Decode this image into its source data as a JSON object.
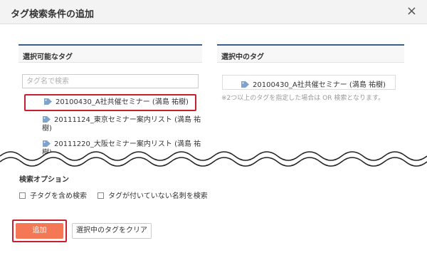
{
  "dialog": {
    "title": "タグ検索条件の追加",
    "close_icon": "×"
  },
  "available": {
    "heading": "選択可能なタグ",
    "search_placeholder": "タグ名で検索",
    "items": [
      {
        "label": "20100430_A社共催セミナー (満島 祐樹)"
      },
      {
        "label": "20111124_東京セミナー案内リスト (満島 祐",
        "wrap": "樹)"
      },
      {
        "label": "20111220_大阪セミナー案内リスト (満島 祐",
        "wrap": "樹)"
      }
    ]
  },
  "selected": {
    "heading": "選択中のタグ",
    "items": [
      {
        "label": "20100430_A社共催セミナー (満島 祐樹)"
      }
    ],
    "note": "※2つ以上のタグを指定した場合は OR 検索となります。"
  },
  "options": {
    "heading": "検索オプション",
    "include_children": "子タグを含め検索",
    "untagged": "タグが付いていない名刺を検索"
  },
  "buttons": {
    "add": "追加",
    "clear": "選択中のタグをクリア"
  },
  "colors": {
    "accent_border": "#3a5f8a",
    "add_button": "#f47855",
    "highlight": "#c62030",
    "tag_icon": "#7fa4cc"
  }
}
